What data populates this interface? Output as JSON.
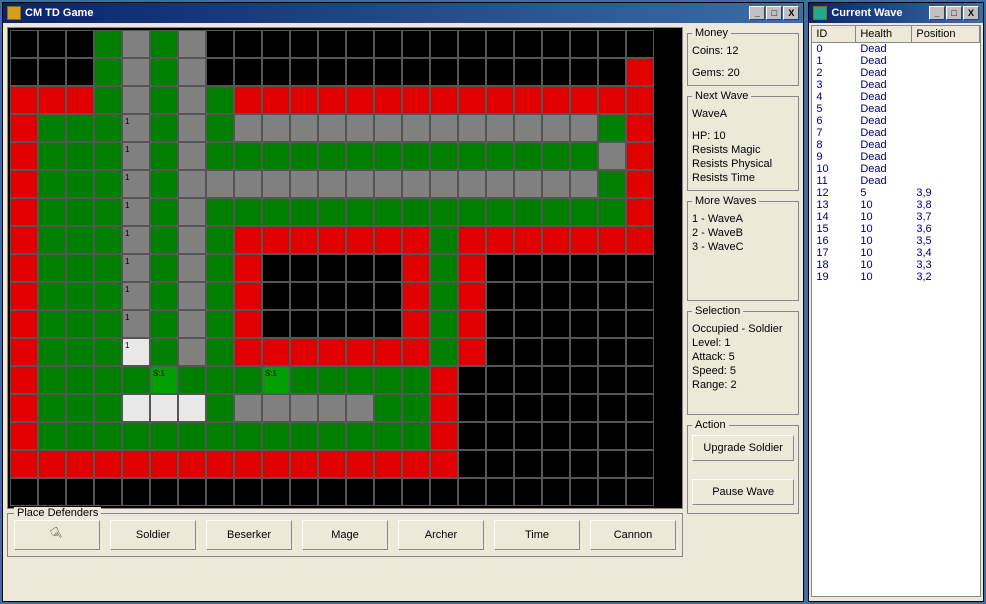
{
  "main": {
    "title": "CM TD Game",
    "money": {
      "legend": "Money",
      "coins_label": "Coins:",
      "coins": "12",
      "gems_label": "Gems:",
      "gems": "20"
    },
    "next_wave": {
      "legend": "Next Wave",
      "name": "WaveA",
      "hp_label": "HP:",
      "hp": "10",
      "r1": "Resists Magic",
      "r2": "Resists Physical",
      "r3": "Resists Time"
    },
    "more_waves": {
      "legend": "More Waves",
      "items": [
        "1 - WaveA",
        "2 - WaveB",
        "3 - WaveC"
      ]
    },
    "selection": {
      "legend": "Selection",
      "occ": "Occupied - Soldier",
      "level": "Level: 1",
      "attack": "Attack: 5",
      "speed": "Speed: 5",
      "range": "Range: 2"
    },
    "action": {
      "legend": "Action",
      "upgrade": "Upgrade Soldier",
      "pause": "Pause Wave"
    },
    "defenders": {
      "legend": "Place Defenders",
      "buttons": [
        "Soldier",
        "Beserker",
        "Mage",
        "Archer",
        "Time",
        "Cannon"
      ]
    }
  },
  "wave_window": {
    "title": "Current Wave",
    "headers": [
      "ID",
      "Health",
      "Position"
    ],
    "rows": [
      {
        "id": "0",
        "h": "Dead",
        "p": ""
      },
      {
        "id": "1",
        "h": "Dead",
        "p": ""
      },
      {
        "id": "2",
        "h": "Dead",
        "p": ""
      },
      {
        "id": "3",
        "h": "Dead",
        "p": ""
      },
      {
        "id": "4",
        "h": "Dead",
        "p": ""
      },
      {
        "id": "5",
        "h": "Dead",
        "p": ""
      },
      {
        "id": "6",
        "h": "Dead",
        "p": ""
      },
      {
        "id": "7",
        "h": "Dead",
        "p": ""
      },
      {
        "id": "8",
        "h": "Dead",
        "p": ""
      },
      {
        "id": "9",
        "h": "Dead",
        "p": ""
      },
      {
        "id": "10",
        "h": "Dead",
        "p": ""
      },
      {
        "id": "11",
        "h": "Dead",
        "p": ""
      },
      {
        "id": "12",
        "h": "5",
        "p": "3,9"
      },
      {
        "id": "13",
        "h": "10",
        "p": "3,8"
      },
      {
        "id": "14",
        "h": "10",
        "p": "3,7"
      },
      {
        "id": "15",
        "h": "10",
        "p": "3,6"
      },
      {
        "id": "16",
        "h": "10",
        "p": "3,5"
      },
      {
        "id": "17",
        "h": "10",
        "p": "3,4"
      },
      {
        "id": "18",
        "h": "10",
        "p": "3,3"
      },
      {
        "id": "19",
        "h": "10",
        "p": "3,2"
      }
    ]
  },
  "grid": {
    "cols": 23,
    "rows": 17,
    "cells": [
      "kkkgygykkkkkkkkkkkkkkkk",
      "kkkgygykkkkkkkkkkkkkkkr",
      "rrrgygygrrrrrrrrrrrrrrr",
      "rgggygygyyyyyyyyyyyyygr",
      "rgggygyggggggggggggggyr",
      "rgggygyyyyyyyyyyyyyyygr",
      "rgggygygggggggggggggggr",
      "rgggygygrrrrrrrgrrrrrrr",
      "rgggygygrkkkkkrgrkkkkkk",
      "rgggygygrkkkkkrgrkkkkkk",
      "rgggygygrkkkkkrgrkkkkkk",
      "rgggwgygrrrrrrrgrkkkkkk",
      "rggggGgggGgggggrkkkkkkk",
      "rgggwwwgyyyyyggrkkkkkkk",
      "rggggggggggggggrkkkkkkk",
      "rrrrrrrrrrrrrrrrkkkkkkk",
      "kkkkkkkkkkkkkkkkkkkkkkk"
    ],
    "overlays": [
      {
        "r": 3,
        "c": 4,
        "t": "1"
      },
      {
        "r": 4,
        "c": 4,
        "t": "1"
      },
      {
        "r": 5,
        "c": 4,
        "t": "1"
      },
      {
        "r": 6,
        "c": 4,
        "t": "1"
      },
      {
        "r": 7,
        "c": 4,
        "t": "1"
      },
      {
        "r": 8,
        "c": 4,
        "t": "1"
      },
      {
        "r": 9,
        "c": 4,
        "t": "1"
      },
      {
        "r": 10,
        "c": 4,
        "t": "1"
      },
      {
        "r": 11,
        "c": 4,
        "t": "1"
      },
      {
        "r": 12,
        "c": 5,
        "t": "S:1"
      },
      {
        "r": 12,
        "c": 9,
        "t": "S:1"
      }
    ]
  }
}
